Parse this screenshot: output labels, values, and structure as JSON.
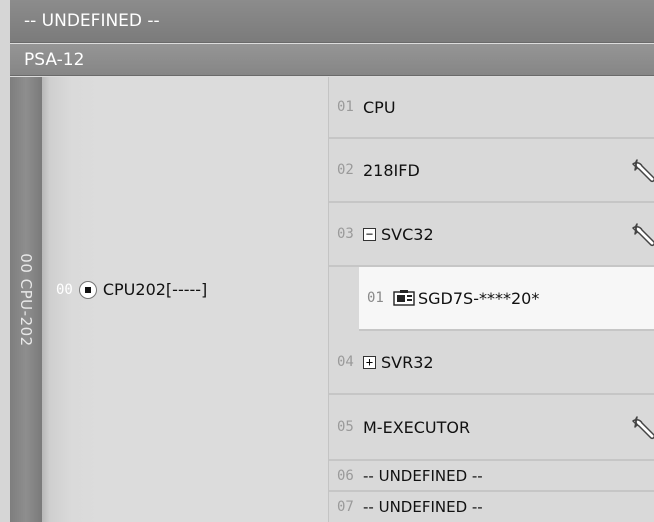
{
  "header": {
    "top_title": "-- UNDEFINED --",
    "unit_name": "PSA-12"
  },
  "rack": {
    "label": "00 CPU-202"
  },
  "cpu": {
    "slot_no": "00",
    "name": "CPU202[-----]"
  },
  "slots": [
    {
      "no": "01",
      "name": "CPU",
      "has_wrench": false
    },
    {
      "no": "02",
      "name": "218IFD",
      "has_wrench": true
    },
    {
      "no": "03",
      "name": "SVC32",
      "has_wrench": true,
      "expander": "−"
    },
    {
      "no": "01",
      "name": "SGD7S-****20*",
      "sub": true
    },
    {
      "no": "04",
      "name": "SVR32",
      "expander": "+"
    },
    {
      "no": "05",
      "name": "M-EXECUTOR",
      "has_wrench": true
    },
    {
      "no": "06",
      "name": "-- UNDEFINED --"
    },
    {
      "no": "07",
      "name": "-- UNDEFINED --"
    }
  ],
  "icons": {
    "wrench": "wrench-icon",
    "expand": "plus-box-icon",
    "collapse": "minus-box-icon",
    "cpu": "cpu-radio-icon",
    "module": "servo-module-icon"
  }
}
